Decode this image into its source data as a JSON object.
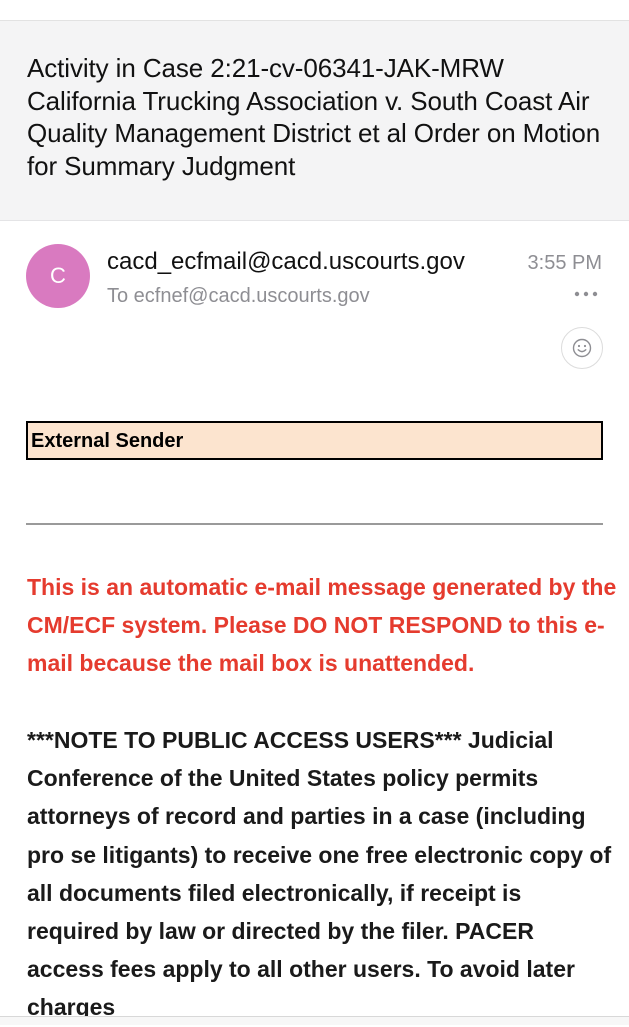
{
  "subject": "Activity in Case 2:21-cv-06341-JAK-MRW California Trucking Association v. South Coast Air Quality Management District et al Order on Motion for Summary Judgment",
  "sender": {
    "avatar_initial": "C",
    "email": "cacd_ecfmail@cacd.uscourts.gov",
    "time": "3:55 PM",
    "recipient": "To ecfnef@cacd.uscourts.gov"
  },
  "icons": {
    "more": "more-horizontal-icon",
    "reaction": "smiley-face-icon"
  },
  "colors": {
    "avatar": "#d97ac0",
    "banner_background": "#fce4cf",
    "auto_message": "#e53b2e"
  },
  "banner": {
    "text": "External Sender"
  },
  "message": {
    "auto_notice": "This is an automatic e-mail message generated by the CM/ECF system. Please DO NOT RESPOND to this e-mail because the mail box is unattended.",
    "body": "***NOTE TO PUBLIC ACCESS USERS*** Judicial Conference of the United States policy permits attorneys of record and parties in a case (including pro se litigants) to receive one free electronic copy of all documents filed electronically, if receipt is required by law or directed by the filer. PACER access fees apply to all other users. To avoid later charges"
  }
}
